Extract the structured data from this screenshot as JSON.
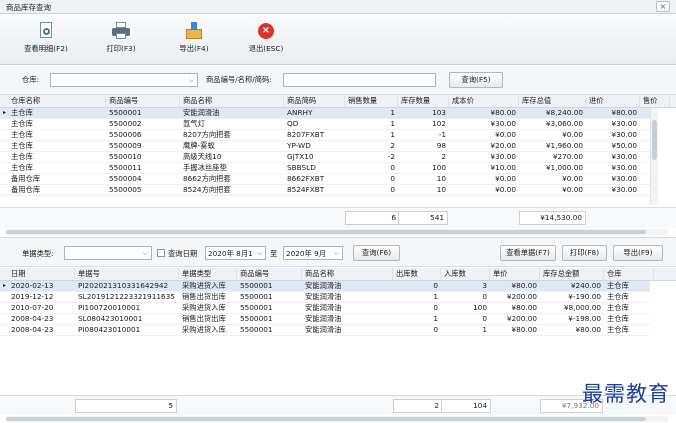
{
  "window": {
    "title": "商品库存查询",
    "close": "×"
  },
  "toolbar": [
    {
      "label": "查看明细(F2)",
      "icon": "document-search-icon"
    },
    {
      "label": "打印(F3)",
      "icon": "printer-icon"
    },
    {
      "label": "导出(F4)",
      "icon": "export-box-icon"
    },
    {
      "label": "退出(ESC)",
      "icon": "exit-icon"
    }
  ],
  "filter": {
    "warehouse_label": "仓库:",
    "warehouse_value": "",
    "product_label": "商品编号/名称/简码:",
    "product_value": "",
    "query_button": "查询(F5)"
  },
  "stock_table": {
    "columns": [
      "仓库名称",
      "商品编号",
      "商品名称",
      "商品简码",
      "销售数量",
      "库存数量",
      "成本价",
      "库存总值",
      "进价",
      "售价"
    ],
    "rows": [
      [
        "主仓库",
        "5500001",
        "安能润滑油",
        "ANRHY",
        "1",
        "103",
        "¥80.00",
        "¥8,240.00",
        "¥80.00"
      ],
      [
        "主仓库",
        "5500002",
        "氙气灯",
        "QD",
        "1",
        "102",
        "¥30.00",
        "¥3,060.00",
        "¥30.00"
      ],
      [
        "主仓库",
        "5500006",
        "8207方向把套",
        "8207FXBT",
        "1",
        "-1",
        "¥0.00",
        "¥0.00",
        "¥30.00"
      ],
      [
        "主仓库",
        "5500009",
        "鹰牌-雾蚁",
        "YP-WD",
        "2",
        "98",
        "¥20.00",
        "¥1,960.00",
        "¥50.00"
      ],
      [
        "主仓库",
        "5500010",
        "高级天线10",
        "GJTX10",
        "-2",
        "2",
        "¥30.00",
        "¥270.00",
        "¥30.00"
      ],
      [
        "主仓库",
        "5500011",
        "手握冰丝座垫",
        "SBBSLD",
        "0",
        "100",
        "¥10.00",
        "¥1,000.00",
        "¥30.00"
      ],
      [
        "备用仓库",
        "5500004",
        "8662方向把套",
        "8662FXBT",
        "0",
        "10",
        "¥0.00",
        "¥0.00",
        "¥30.00"
      ],
      [
        "备用仓库",
        "5500005",
        "8524方向把套",
        "8524FXBT",
        "0",
        "10",
        "¥0.00",
        "¥0.00",
        "¥30.00"
      ]
    ],
    "totals": {
      "sales": "6",
      "stock": "541",
      "value": "¥14,530.00"
    }
  },
  "detail_filter": {
    "type_label": "单据类型:",
    "type_value": "",
    "date_check_label": "查询日期",
    "date_from": "2020年 8月1",
    "date_to_label": "至",
    "date_to": "2020年 9月",
    "query_button": "查询(F6)",
    "view_button": "查看单据(F7)",
    "print_button": "打印(F8)",
    "export_button": "导出(F9)"
  },
  "detail_table": {
    "columns": [
      "日期",
      "单据号",
      "单据类型",
      "商品编号",
      "商品名称",
      "出库数",
      "入库数",
      "单价",
      "库存总金额",
      "仓库"
    ],
    "rows": [
      [
        "2020-02-13",
        "PI20202131033164294​2",
        "采购进货入库",
        "5500001",
        "安能润滑油",
        "0",
        "3",
        "¥80.00",
        "¥240.00",
        "主仓库"
      ],
      [
        "2019-12-12",
        "SL20191212233219116​35",
        "销售出货出库",
        "5500001",
        "安能润滑油",
        "1",
        "0",
        "¥200.00",
        "¥-190.00",
        "主仓库"
      ],
      [
        "2010-07-20",
        "PI100720010001",
        "采购进货入库",
        "5500001",
        "安能润滑油",
        "0",
        "100",
        "¥80.00",
        "¥8,000.00",
        "主仓库"
      ],
      [
        "2008-04-23",
        "SL080423010001",
        "销售出货出库",
        "5500001",
        "安能润滑油",
        "1",
        "0",
        "¥200.00",
        "¥-198.00",
        "主仓库"
      ],
      [
        "2008-04-23",
        "PI080423010001",
        "采购进货入库",
        "5500001",
        "安能润滑油",
        "0",
        "1",
        "¥80.00",
        "¥80.00",
        "主仓库"
      ]
    ],
    "totals": {
      "count": "5",
      "out": "2",
      "in": "104",
      "amount": "¥7,932.00"
    }
  },
  "watermark": "最需教育"
}
